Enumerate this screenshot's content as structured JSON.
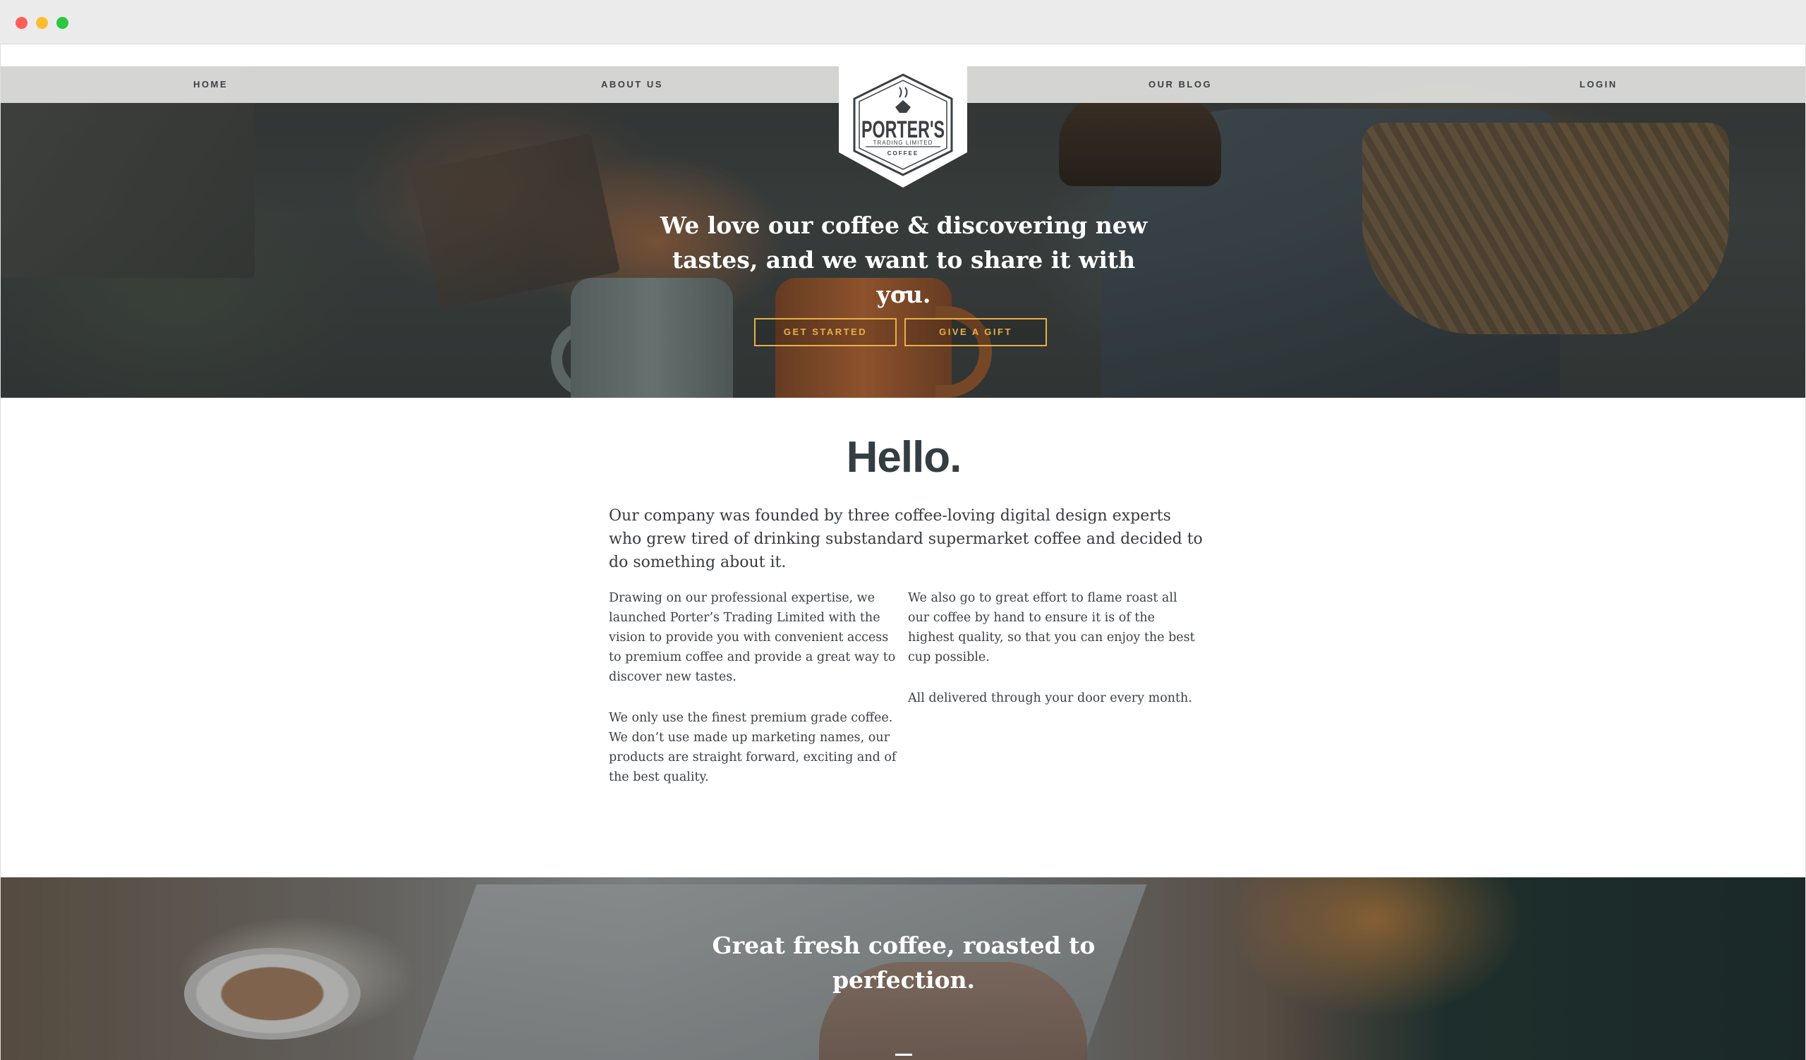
{
  "nav": {
    "home": "HOME",
    "about": "ABOUT US",
    "blog": "OUR BLOG",
    "login": "LOGIN"
  },
  "logo": {
    "name": "PORTER'S",
    "subtitle": "TRADING LIMITED",
    "product": "COFFEE"
  },
  "hero": {
    "tagline": "We love our coffee & discovering new tastes, and we want to share it with you.",
    "buttons": {
      "start": "GET STARTED",
      "gift": "GIVE A GIFT"
    }
  },
  "about": {
    "heading": "Hello.",
    "lead": "Our company was founded by three coffee-loving digital design experts who grew tired of drinking substandard supermarket coffee and decided to do something about it.",
    "left": [
      "Drawing on our professional expertise, we launched Porter’s Trading Limited with the vision to provide you with convenient access to premium coffee and provide a great way to discover new tastes.",
      "We only use the finest premium grade coffee. We don’t use made up marketing names, our products are straight forward, exciting and of the best quality."
    ],
    "right": [
      "We also go to great effort to flame roast all our coffee by hand to ensure it is of the highest quality, so that you can enjoy the best cup possible.",
      "All delivered through your door every month."
    ]
  },
  "banner": {
    "text": "Great fresh coffee, roasted to perfection."
  },
  "colors": {
    "accent": "#e9b046",
    "heading": "#343d42",
    "body_text": "#3b4145"
  }
}
